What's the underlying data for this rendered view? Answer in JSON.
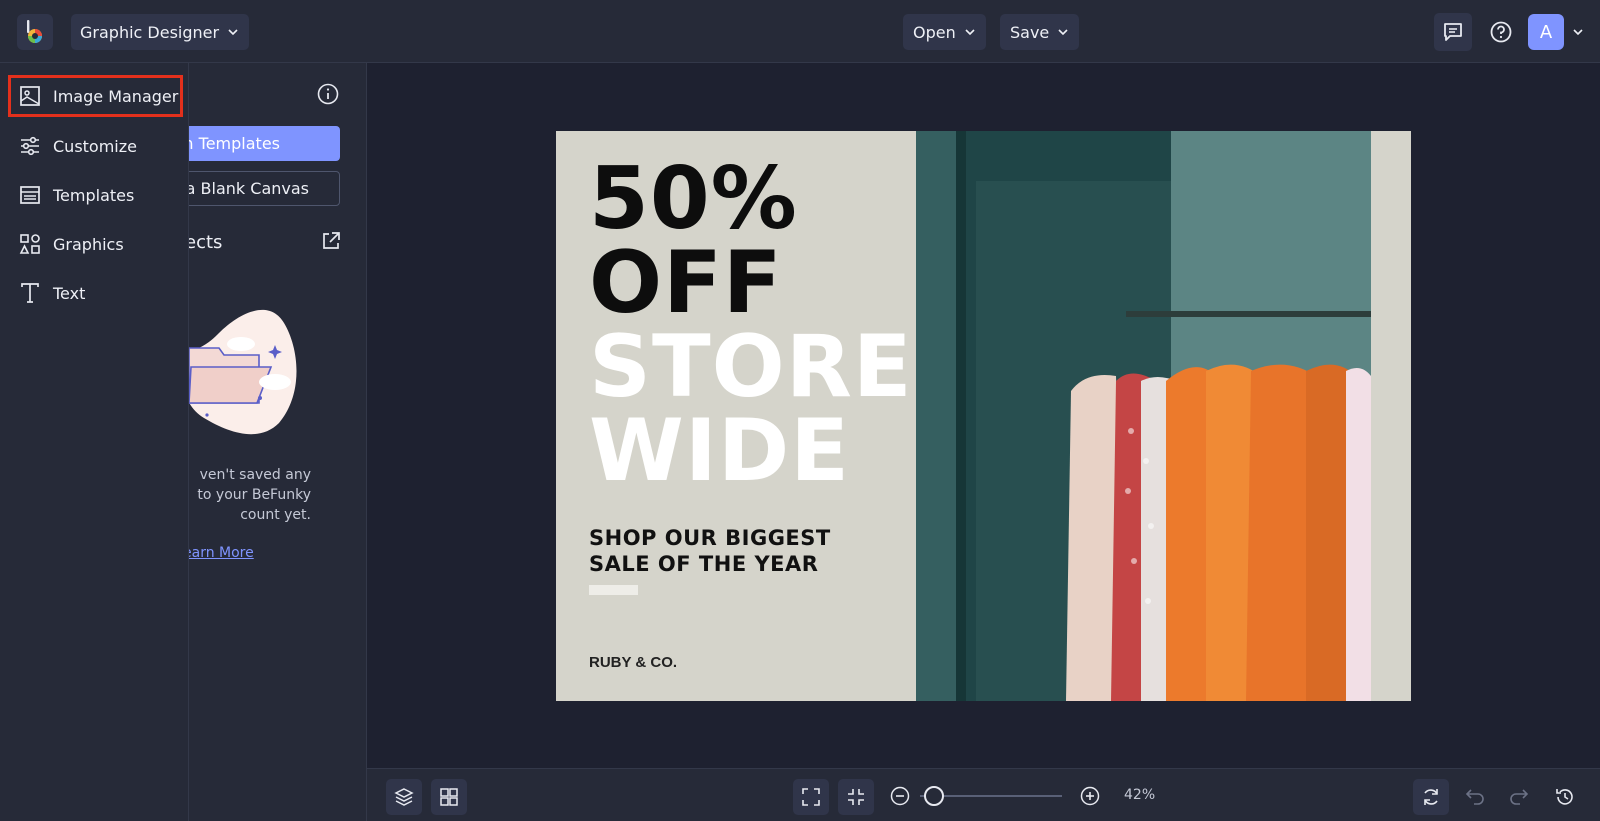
{
  "header": {
    "logo_icon": "befunky-logo-icon",
    "app_name": "Graphic Designer",
    "open_label": "Open",
    "save_label": "Save",
    "avatar_initial": "A",
    "icons": [
      "comments-icon",
      "help-icon",
      "chevron-down-icon"
    ]
  },
  "leftnav": {
    "items": [
      {
        "label": "Image Manager",
        "icon": "image-icon",
        "highlighted": true
      },
      {
        "label": "Customize",
        "icon": "sliders-icon"
      },
      {
        "label": "Templates",
        "icon": "template-icon"
      },
      {
        "label": "Graphics",
        "icon": "shapes-icon"
      },
      {
        "label": "Text",
        "icon": "text-icon"
      }
    ]
  },
  "panel": {
    "start_templates": "Start with Templates",
    "start_templates_visible": "th Templates",
    "blank_canvas": "Start on a Blank Canvas",
    "blank_canvas_visible": "n a Blank Canvas",
    "projects_visible": "ects",
    "empty_lines": [
      "ven't saved any",
      "to your BeFunky",
      "count yet."
    ],
    "learn_more_visible": "earn More"
  },
  "design": {
    "line1": "50%",
    "line2": "OFF",
    "line3": "STORE",
    "line4": "WIDE",
    "sub1": "SHOP OUR BIGGEST",
    "sub2": "SALE OF THE YEAR",
    "brand": "RUBY & CO."
  },
  "bottombar": {
    "zoom": "42%",
    "zoom_level_percent": 42,
    "icons": [
      "layers-icon",
      "grid-icon",
      "fit-screen-icon",
      "actual-size-icon",
      "zoom-out-icon",
      "zoom-in-icon",
      "refresh-icon",
      "undo-icon",
      "redo-icon",
      "history-icon"
    ]
  }
}
